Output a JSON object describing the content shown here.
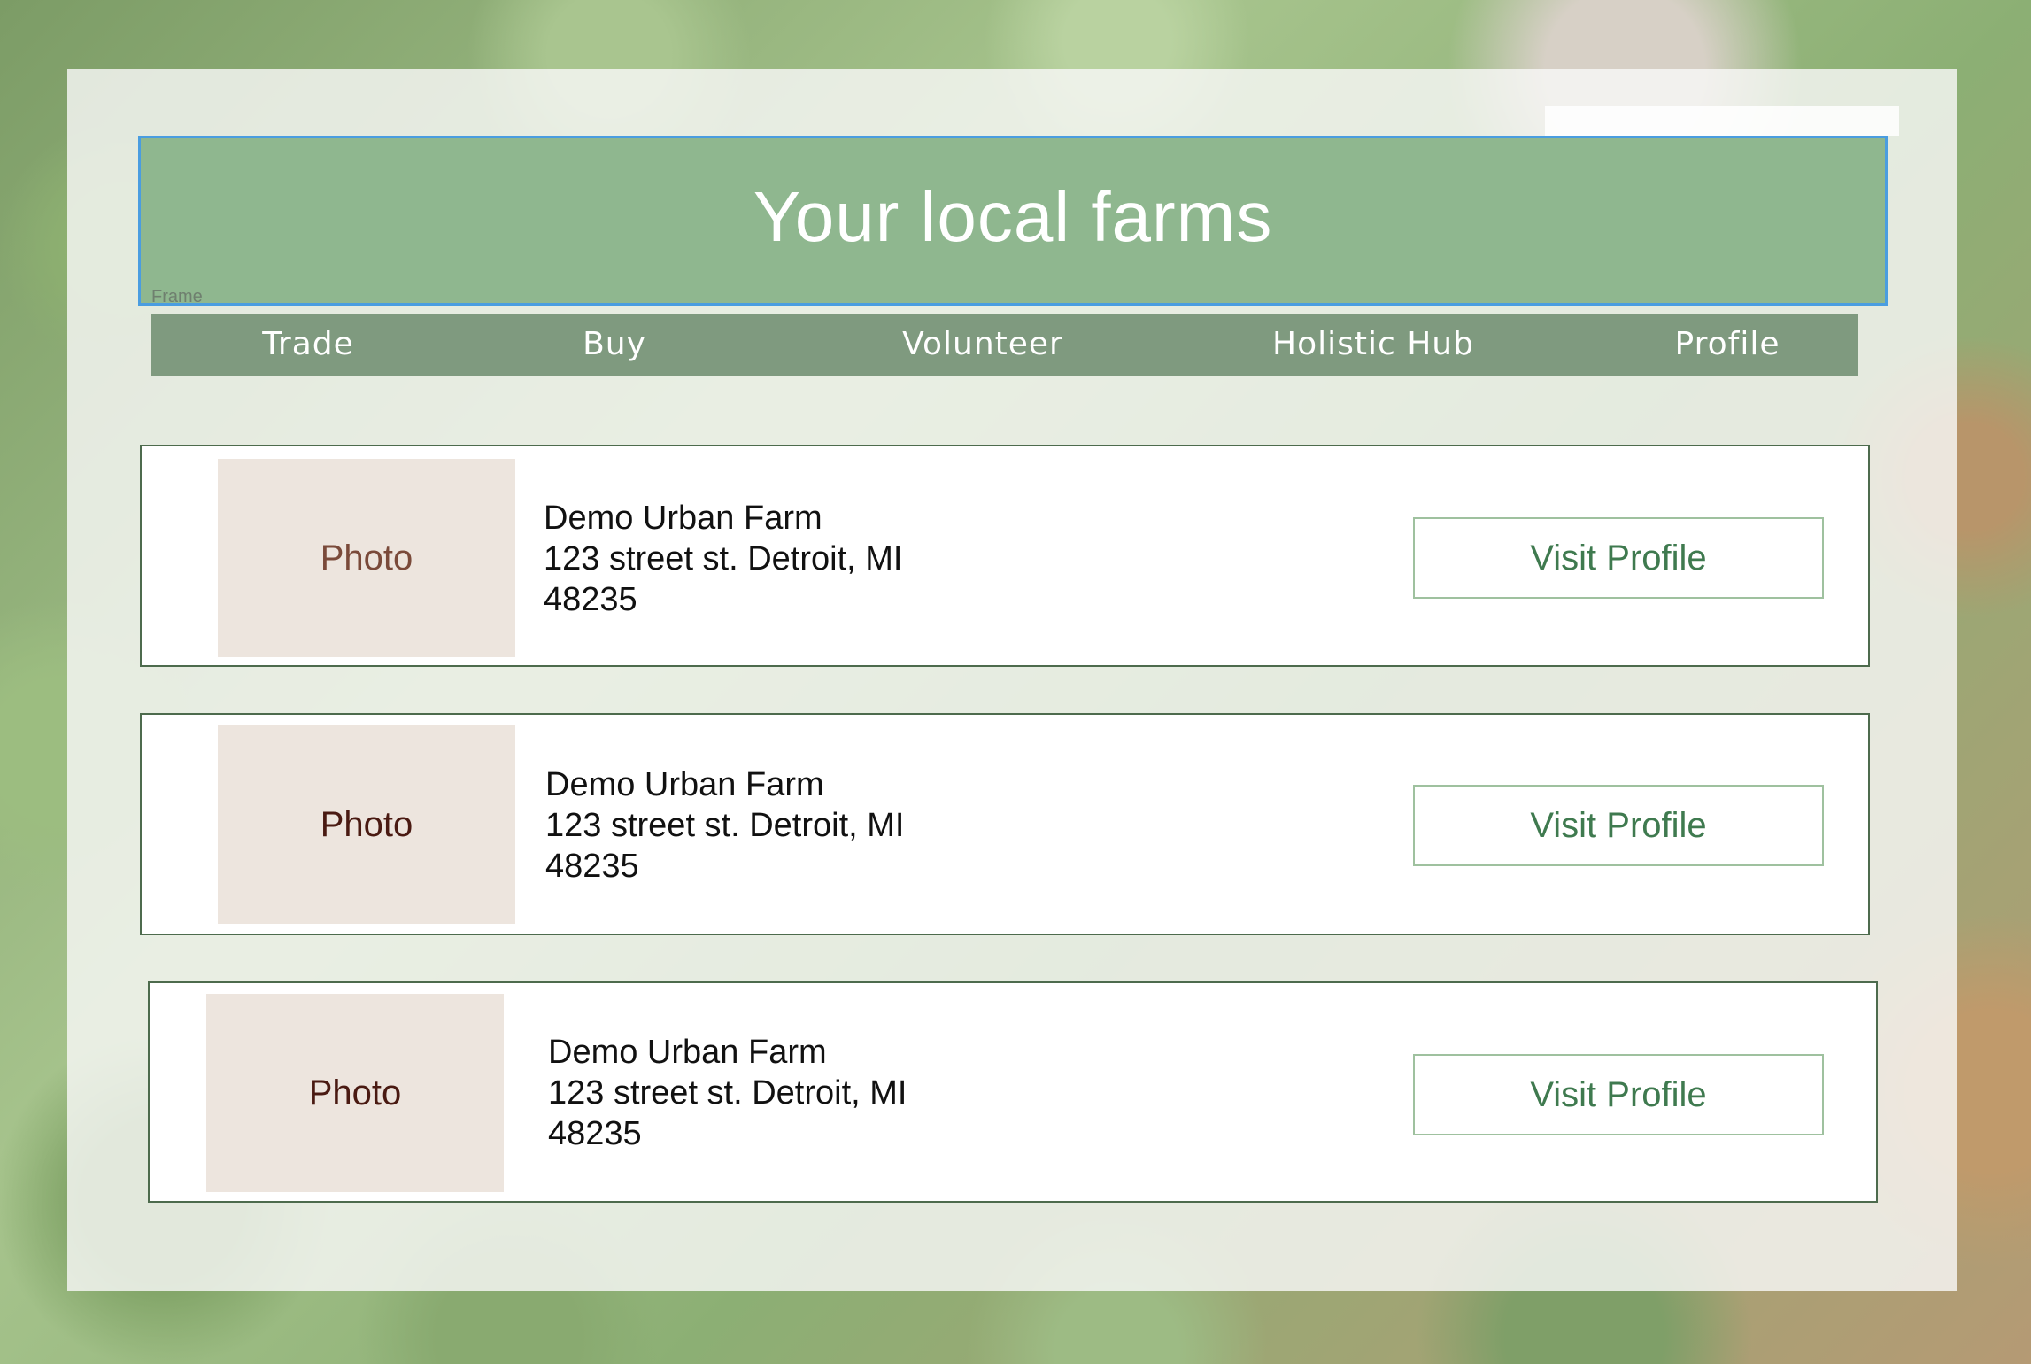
{
  "header": {
    "title": "Your local farms",
    "frame_label": "Frame"
  },
  "nav": {
    "items": [
      {
        "label": "Trade"
      },
      {
        "label": "Buy"
      },
      {
        "label": "Volunteer"
      },
      {
        "label": "Holistic Hub"
      },
      {
        "label": "Profile"
      }
    ]
  },
  "farms": [
    {
      "photo_label": "Photo",
      "name": "Demo Urban Farm",
      "address_line1": "123 street st. Detroit, MI",
      "address_line2": "48235",
      "button_label": "Visit Profile"
    },
    {
      "photo_label": "Photo",
      "name": "Demo Urban Farm",
      "address_line1": "123 street st. Detroit, MI",
      "address_line2": "48235",
      "button_label": "Visit Profile"
    },
    {
      "photo_label": "Photo",
      "name": "Demo Urban Farm",
      "address_line1": "123 street st. Detroit, MI",
      "address_line2": "48235",
      "button_label": "Visit Profile"
    }
  ],
  "colors": {
    "header_bg": "#8fb78f",
    "nav_bg": "#7f9a7f",
    "card_border": "#4d6b4d",
    "photo_bg": "#ede5de",
    "photo_text_1": "#7a4a3a",
    "photo_text_2": "#4a1a12",
    "button_text": "#3f7a4f",
    "button_border": "#9fc19f",
    "selection_outline": "#4a9de0"
  }
}
